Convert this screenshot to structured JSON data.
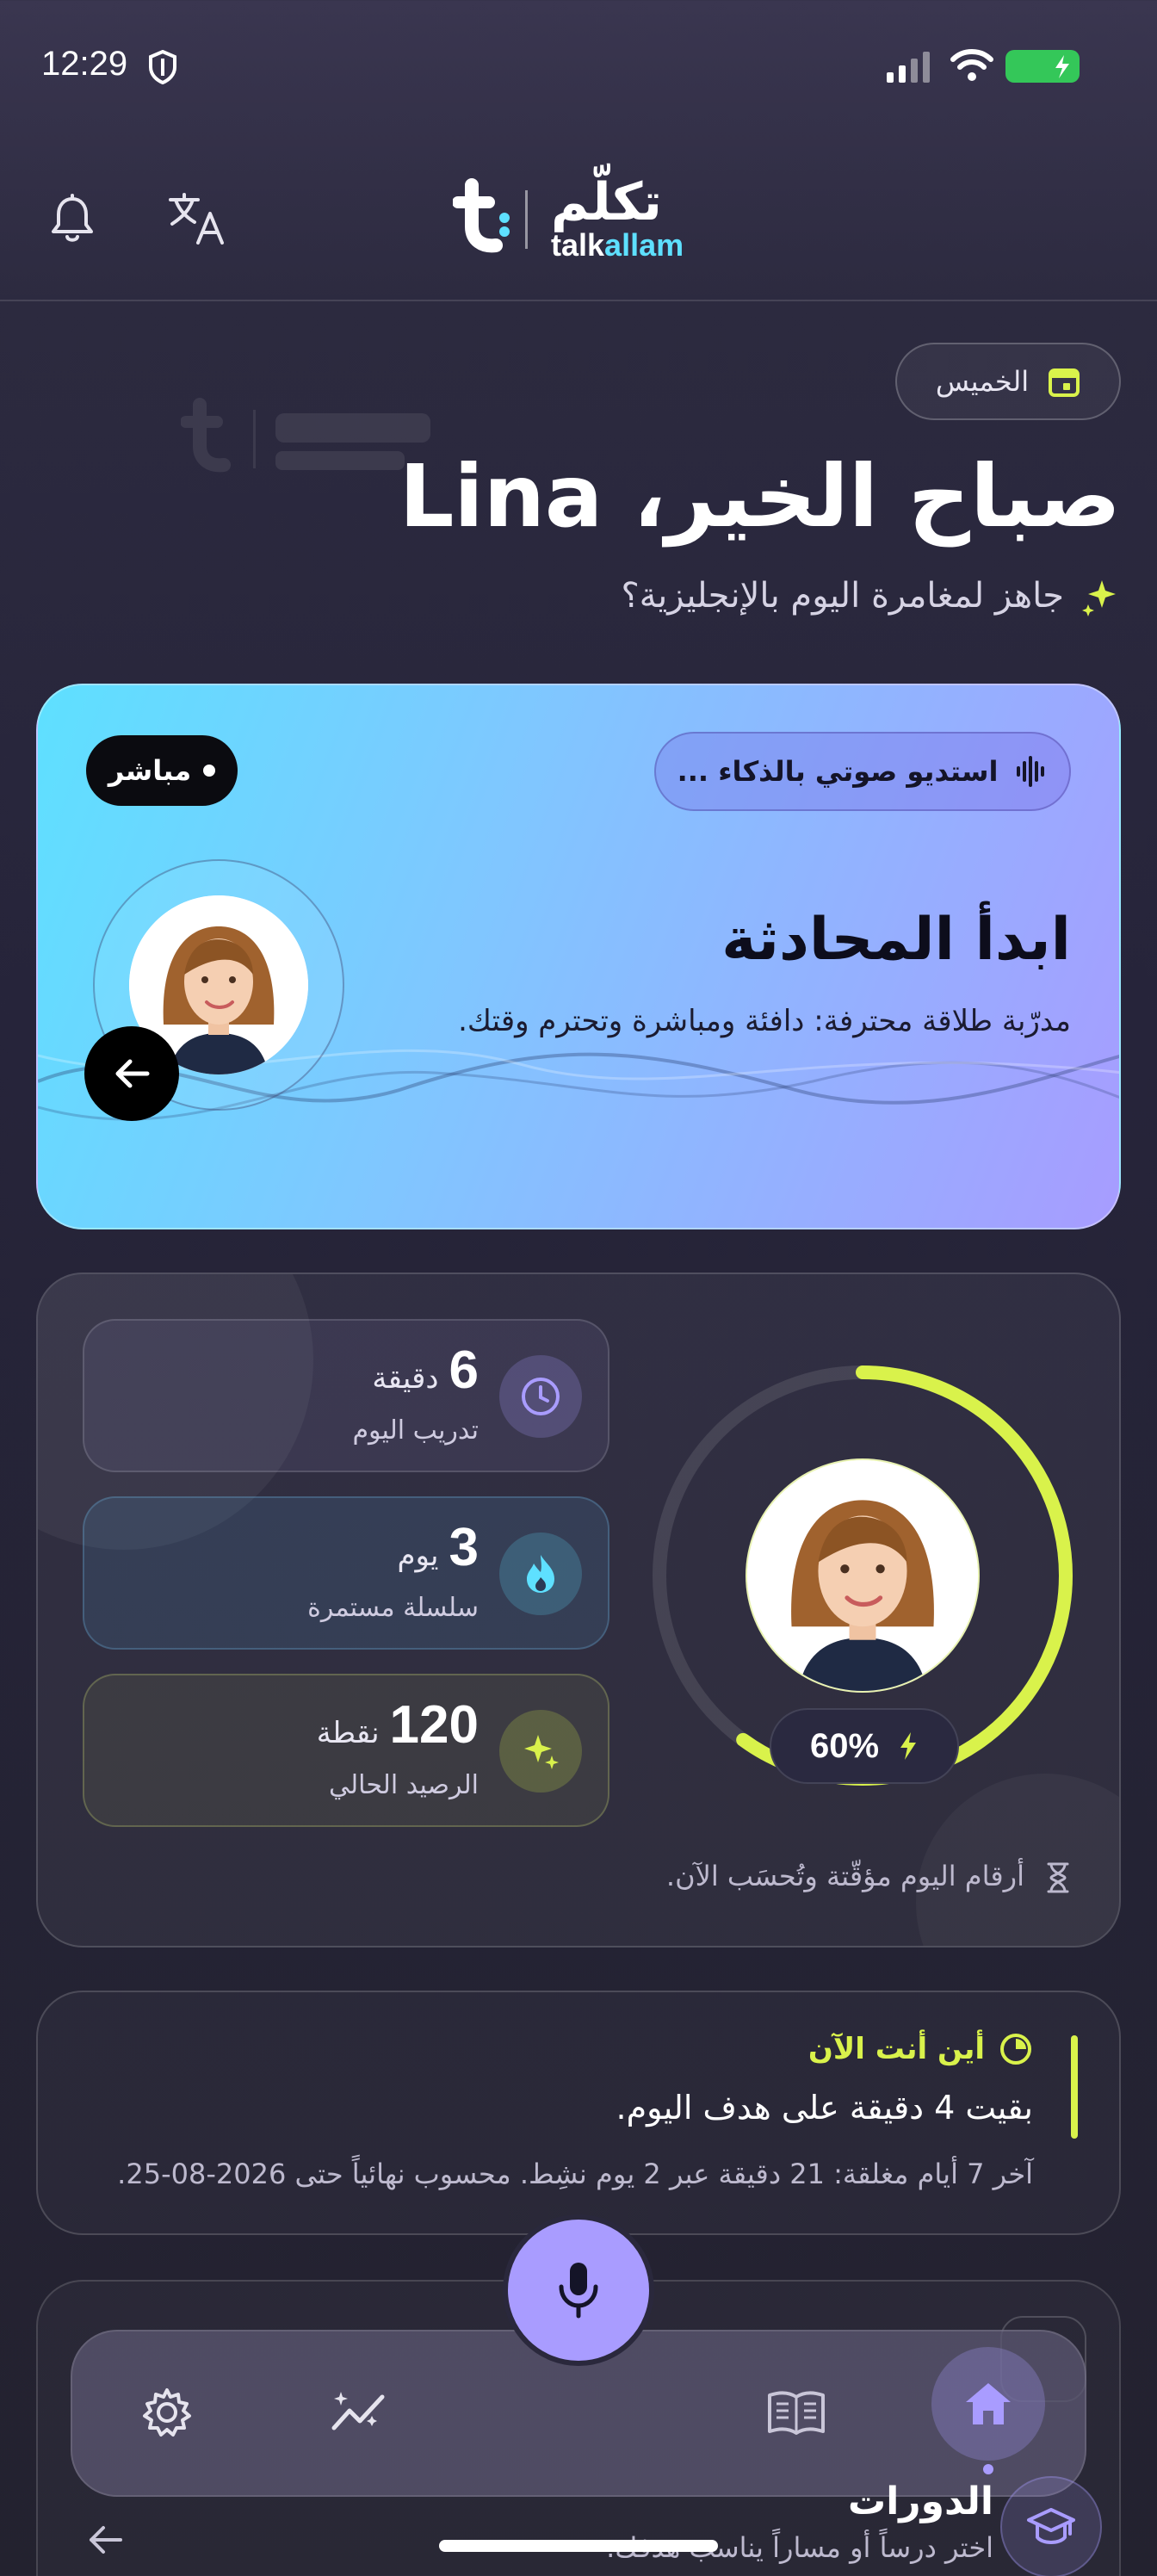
{
  "status_bar": {
    "time": "12:29"
  },
  "header": {
    "logo_arabic": "تكلّم",
    "logo_latin_a": "talk",
    "logo_latin_b": "allam"
  },
  "greeting": {
    "day": "الخميس",
    "title": "صباح الخير، Lina",
    "subtitle": "جاهز لمغامرة اليوم بالإنجليزية؟"
  },
  "hero": {
    "live_label": "مباشر",
    "studio_label": "استديو صوتي بالذكاء ...",
    "title": "ابدأ المحادثة",
    "description": "مدرّبة طلاقة محترفة: دافئة ومباشرة وتحترم وقتك."
  },
  "stats": {
    "items": [
      {
        "value": "6",
        "unit": "دقيقة",
        "label": "تدريب اليوم"
      },
      {
        "value": "3",
        "unit": "يوم",
        "label": "سلسلة مستمرة"
      },
      {
        "value": "120",
        "unit": "نقطة",
        "label": "الرصيد الحالي"
      }
    ],
    "progress_label": "60%",
    "progress_value": 0.6,
    "note": "أرقام اليوم مؤقّتة وتُحسَب الآن."
  },
  "where": {
    "title": "أين أنت الآن",
    "main": "بقيت 4 دقيقة على هدف اليوم.",
    "sub": "آخر 7 أيام مغلقة: 21 دقيقة عبر 2 يوم نشِط. محسوب نهائياً حتى 2026-08-25."
  },
  "courses": {
    "title": "الدورات",
    "subtitle": "اختر درساً أو مساراً يناسب هدفك."
  },
  "colors": {
    "accent_lime": "#d9f24b",
    "accent_violet": "#a99cff",
    "accent_cyan": "#5ee0ff"
  }
}
